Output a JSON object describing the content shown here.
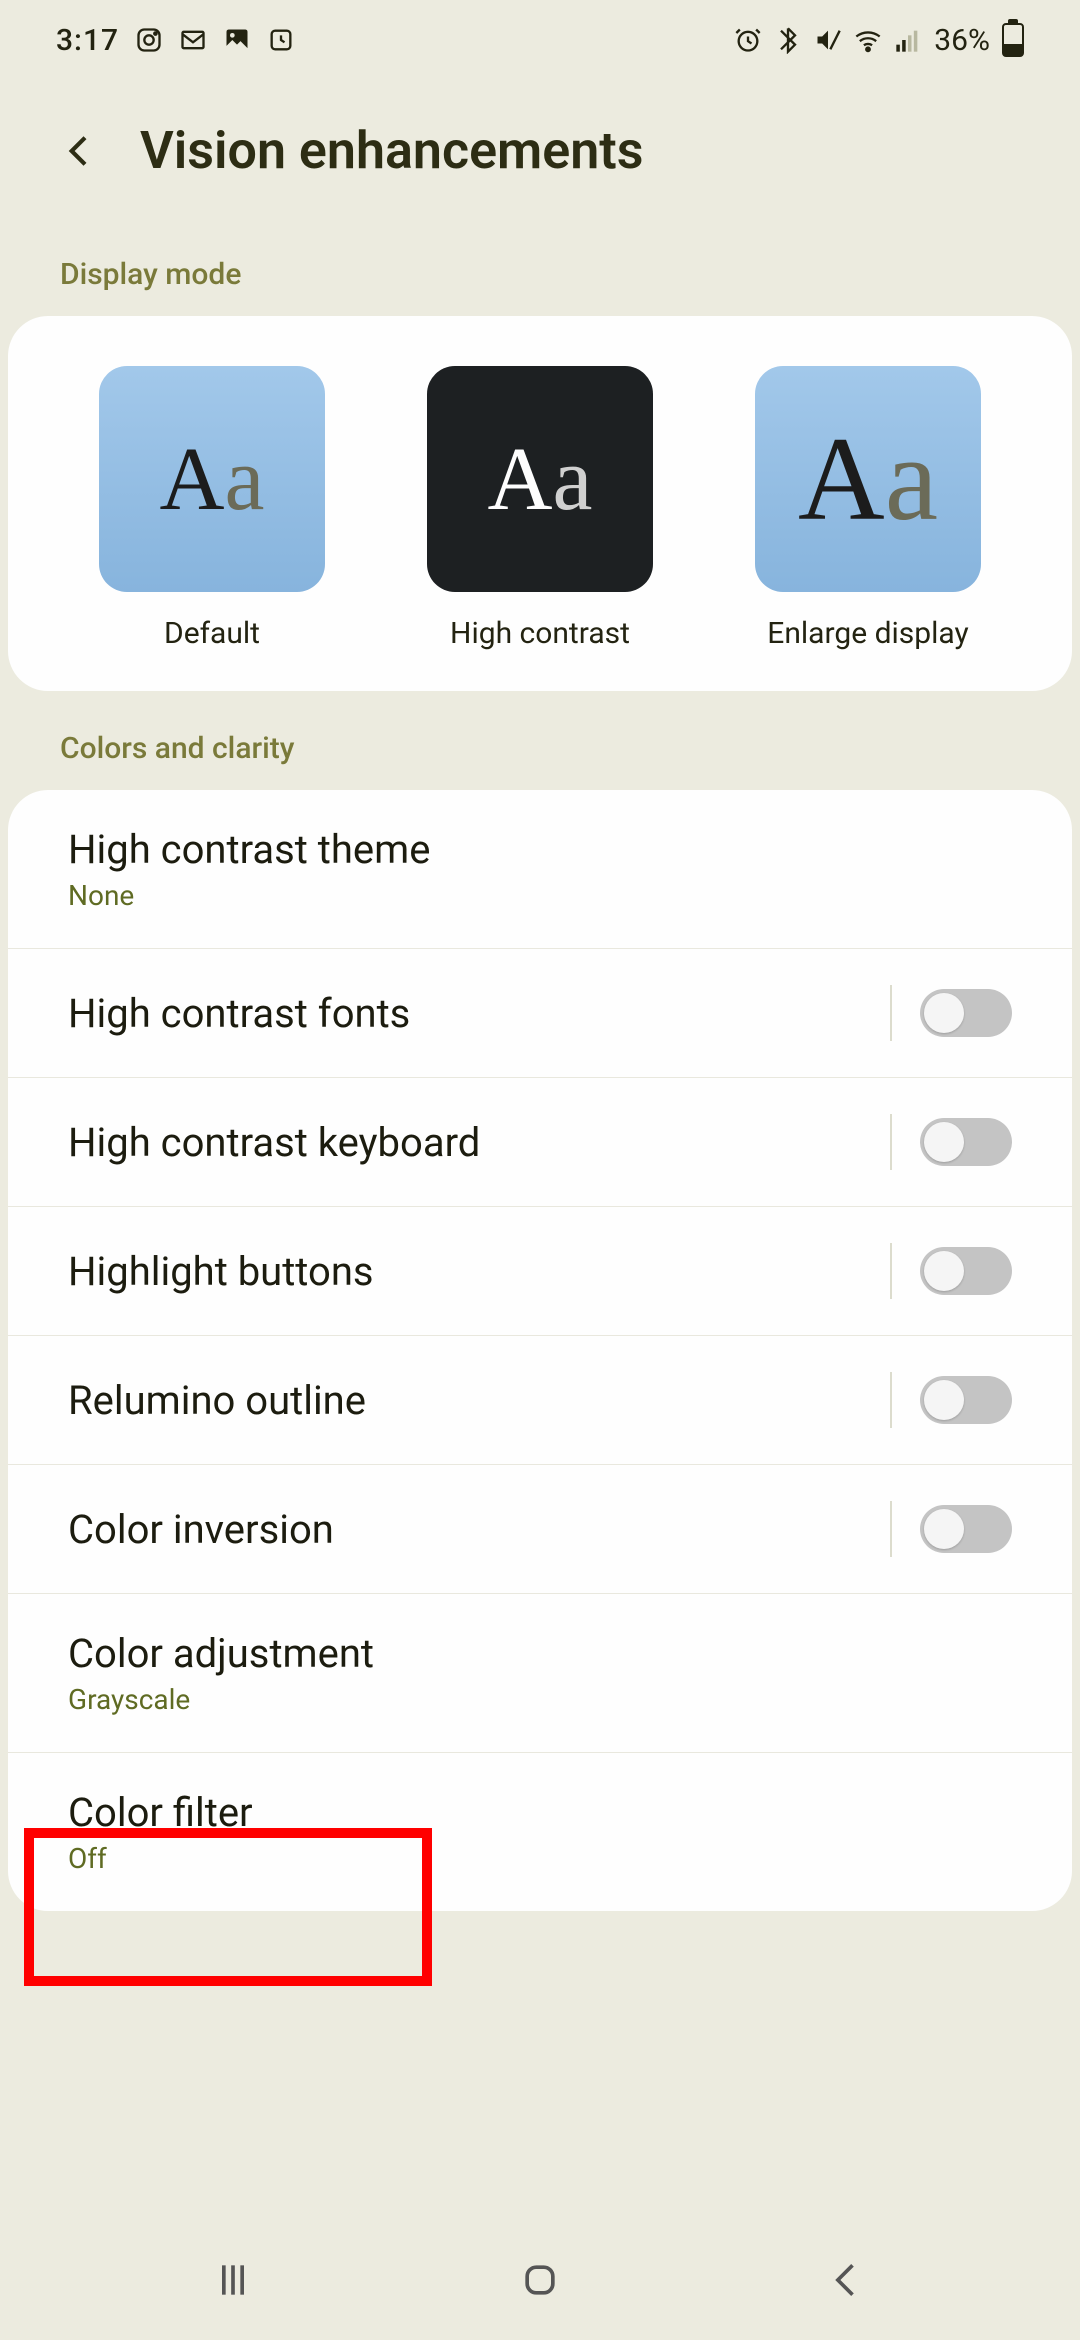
{
  "status": {
    "time": "3:17",
    "battery_text": "36%"
  },
  "header": {
    "title": "Vision enhancements"
  },
  "sections": {
    "display_mode_label": "Display mode",
    "colors_clarity_label": "Colors and clarity"
  },
  "display_modes": {
    "default": "Default",
    "high_contrast": "High contrast",
    "enlarge": "Enlarge display"
  },
  "rows": {
    "high_contrast_theme": {
      "title": "High contrast theme",
      "sub": "None"
    },
    "high_contrast_fonts": {
      "title": "High contrast fonts"
    },
    "high_contrast_keyboard": {
      "title": "High contrast keyboard"
    },
    "highlight_buttons": {
      "title": "Highlight buttons"
    },
    "relumino_outline": {
      "title": "Relumino outline"
    },
    "color_inversion": {
      "title": "Color inversion"
    },
    "color_adjustment": {
      "title": "Color adjustment",
      "sub": "Grayscale"
    },
    "color_filter": {
      "title": "Color filter",
      "sub": "Off"
    }
  }
}
